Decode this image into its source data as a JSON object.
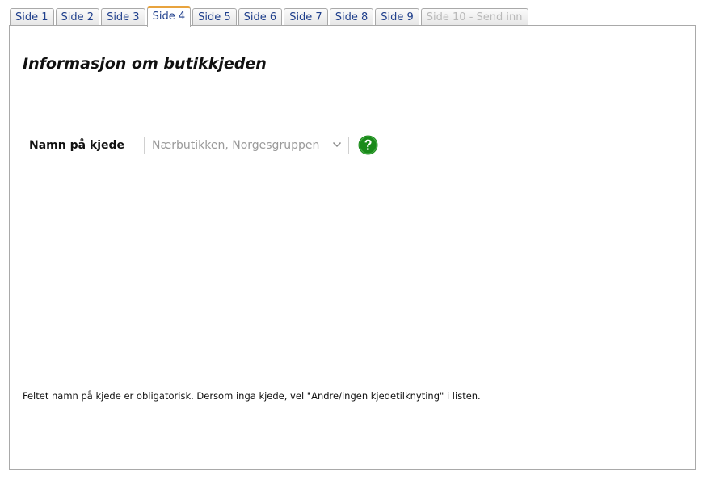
{
  "tabs": [
    {
      "label": "Side 1",
      "state": "normal"
    },
    {
      "label": "Side 2",
      "state": "normal"
    },
    {
      "label": "Side 3",
      "state": "normal"
    },
    {
      "label": "Side 4",
      "state": "active"
    },
    {
      "label": "Side 5",
      "state": "normal"
    },
    {
      "label": "Side 6",
      "state": "normal"
    },
    {
      "label": "Side 7",
      "state": "normal"
    },
    {
      "label": "Side 8",
      "state": "normal"
    },
    {
      "label": "Side 9",
      "state": "normal"
    },
    {
      "label": "Side 10 - Send inn",
      "state": "disabled"
    }
  ],
  "page": {
    "title": "Informasjon om butikkjeden"
  },
  "chain_field": {
    "label": "Namn på kjede",
    "value": "Nærbutikken, Norgesgruppen",
    "help_icon": "question-circle-icon"
  },
  "footnote": "Feltet namn på kjede er obligatorisk. Dersom inga kjede, vel \"Andre/ingen kjedetilknyting\" i listen.",
  "colors": {
    "tab_text": "#1f3f8c",
    "active_tab_accent": "#e8a33d",
    "disabled_tab_text": "#b9b9b9",
    "help_icon_green": "#1a8a1a"
  }
}
